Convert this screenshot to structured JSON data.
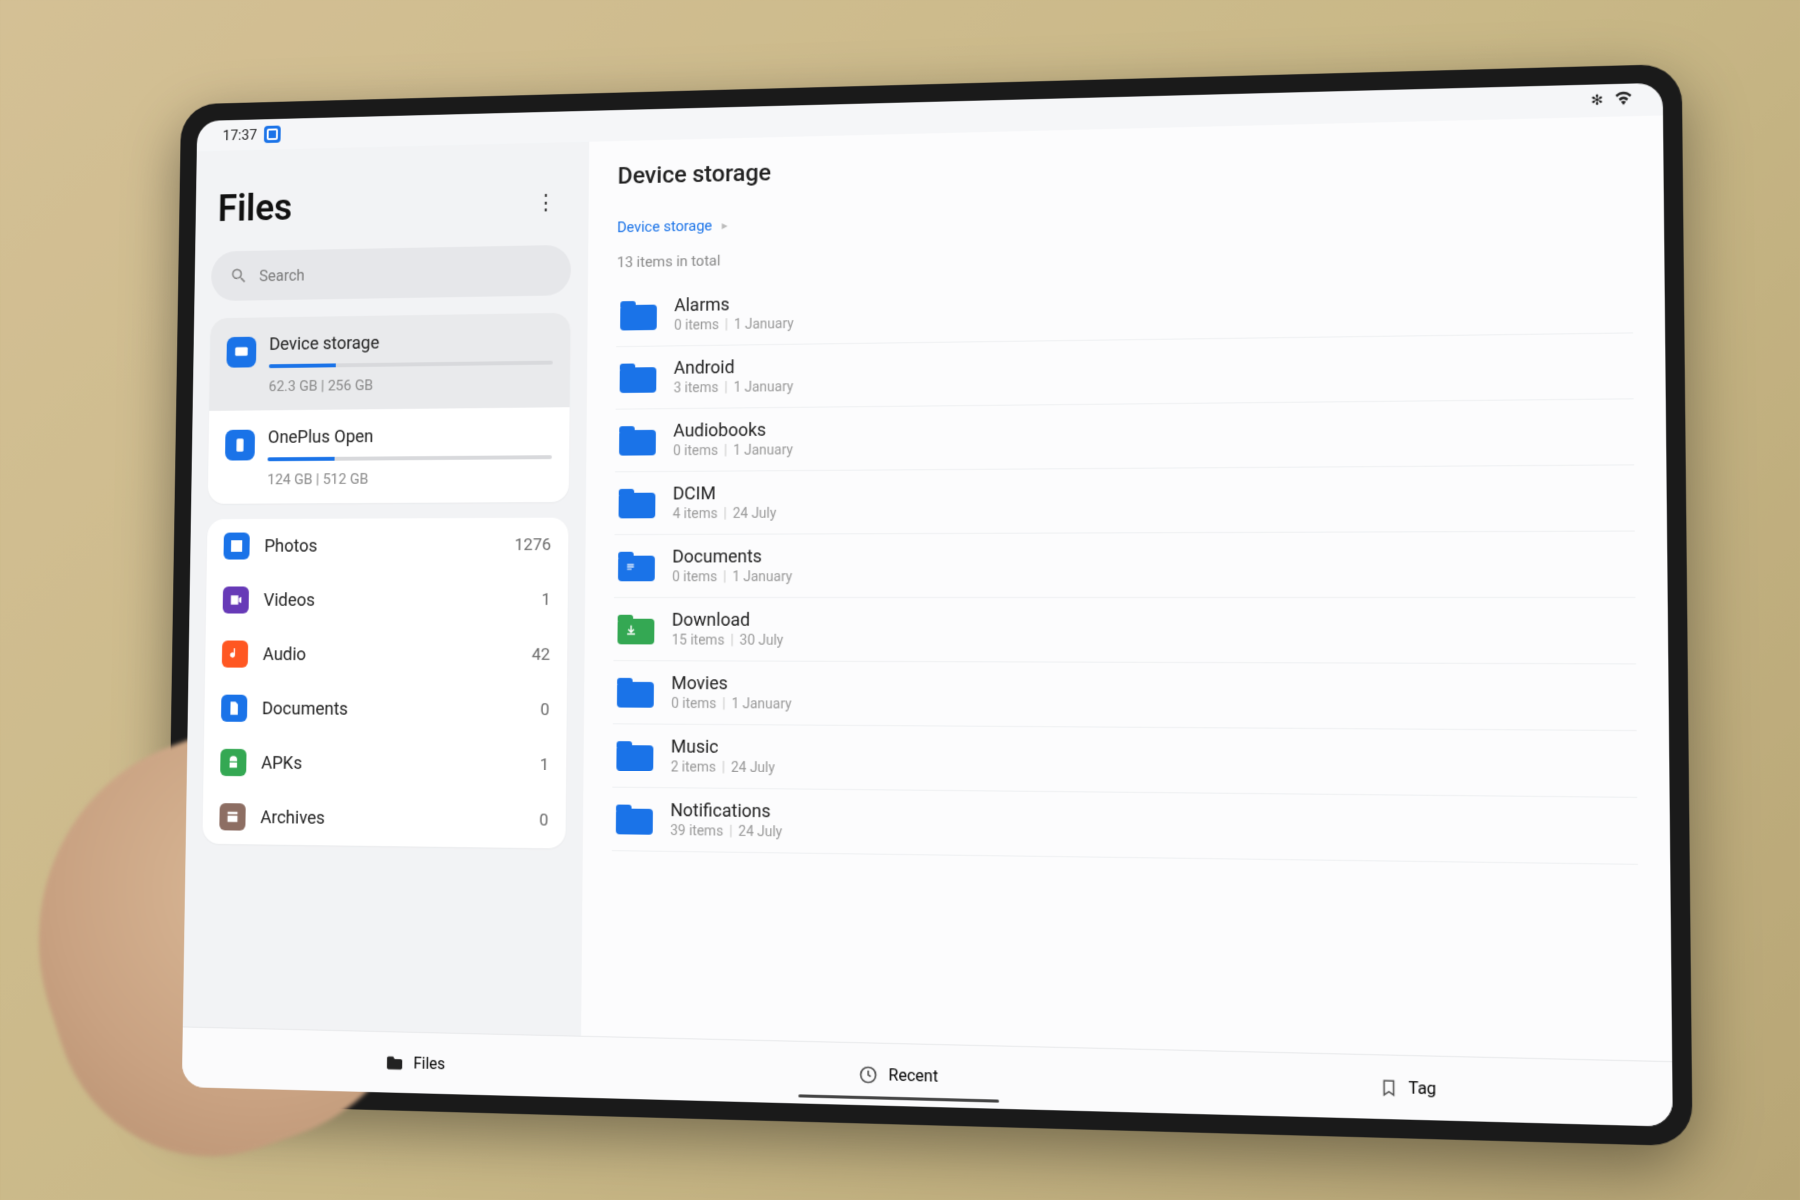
{
  "status": {
    "time": "17:37"
  },
  "app": {
    "title": "Files"
  },
  "search": {
    "placeholder": "Search"
  },
  "storage": [
    {
      "name": "Device storage",
      "used": "62.3 GB",
      "total": "256 GB",
      "percent": 24,
      "selected": true,
      "icon": "monitor"
    },
    {
      "name": "OnePlus Open",
      "used": "124 GB",
      "total": "512 GB",
      "percent": 24,
      "selected": false,
      "icon": "phone"
    }
  ],
  "categories": [
    {
      "name": "Photos",
      "count": "1276",
      "color": "#1a73e8",
      "glyph": "image"
    },
    {
      "name": "Videos",
      "count": "1",
      "color": "#673ab7",
      "glyph": "video"
    },
    {
      "name": "Audio",
      "count": "42",
      "color": "#ff5722",
      "glyph": "audio"
    },
    {
      "name": "Documents",
      "count": "0",
      "color": "#1a73e8",
      "glyph": "doc"
    },
    {
      "name": "APKs",
      "count": "1",
      "color": "#34a853",
      "glyph": "apk"
    },
    {
      "name": "Archives",
      "count": "0",
      "color": "#8d6e63",
      "glyph": "archive"
    }
  ],
  "main": {
    "title": "Device storage",
    "breadcrumb": "Device storage",
    "total_label": "13 items in total",
    "folders": [
      {
        "name": "Alarms",
        "items": "0 items",
        "date": "1 January",
        "style": "blue"
      },
      {
        "name": "Android",
        "items": "3 items",
        "date": "1 January",
        "style": "blue"
      },
      {
        "name": "Audiobooks",
        "items": "0 items",
        "date": "1 January",
        "style": "blue"
      },
      {
        "name": "DCIM",
        "items": "4 items",
        "date": "24 July",
        "style": "blue"
      },
      {
        "name": "Documents",
        "items": "0 items",
        "date": "1 January",
        "style": "docblue"
      },
      {
        "name": "Download",
        "items": "15 items",
        "date": "30 July",
        "style": "green"
      },
      {
        "name": "Movies",
        "items": "0 items",
        "date": "1 January",
        "style": "blue"
      },
      {
        "name": "Music",
        "items": "2 items",
        "date": "24 July",
        "style": "blue"
      },
      {
        "name": "Notifications",
        "items": "39 items",
        "date": "24 July",
        "style": "blue"
      }
    ]
  },
  "nav": {
    "files": "Files",
    "recent": "Recent",
    "tag": "Tag"
  }
}
